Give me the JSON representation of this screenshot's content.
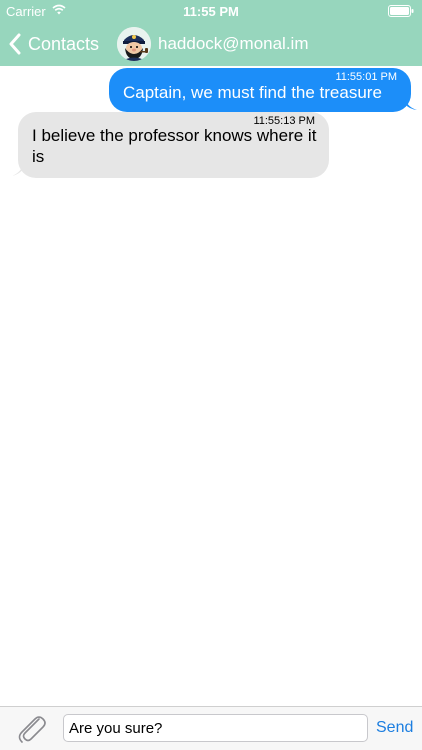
{
  "status_bar": {
    "carrier": "Carrier",
    "time": "11:55 PM"
  },
  "nav": {
    "back_label": "Contacts",
    "contact_name": "haddock@monal.im",
    "back_icon": "chevron-left-icon",
    "avatar_icon": "captain-avatar"
  },
  "messages": [
    {
      "direction": "outgoing",
      "time": "11:55:01 PM",
      "text": "Captain, we must find the treasure"
    },
    {
      "direction": "incoming",
      "time": "11:55:13 PM",
      "text": "I believe the professor knows where it is"
    }
  ],
  "composer": {
    "value": "Are you sure?",
    "send_label": "Send",
    "attach_icon": "paperclip-icon"
  },
  "colors": {
    "header": "#97d6bd",
    "outgoing_bubble": "#1c8ef9",
    "incoming_bubble": "#e6e6e6",
    "send": "#1c7ee0"
  }
}
